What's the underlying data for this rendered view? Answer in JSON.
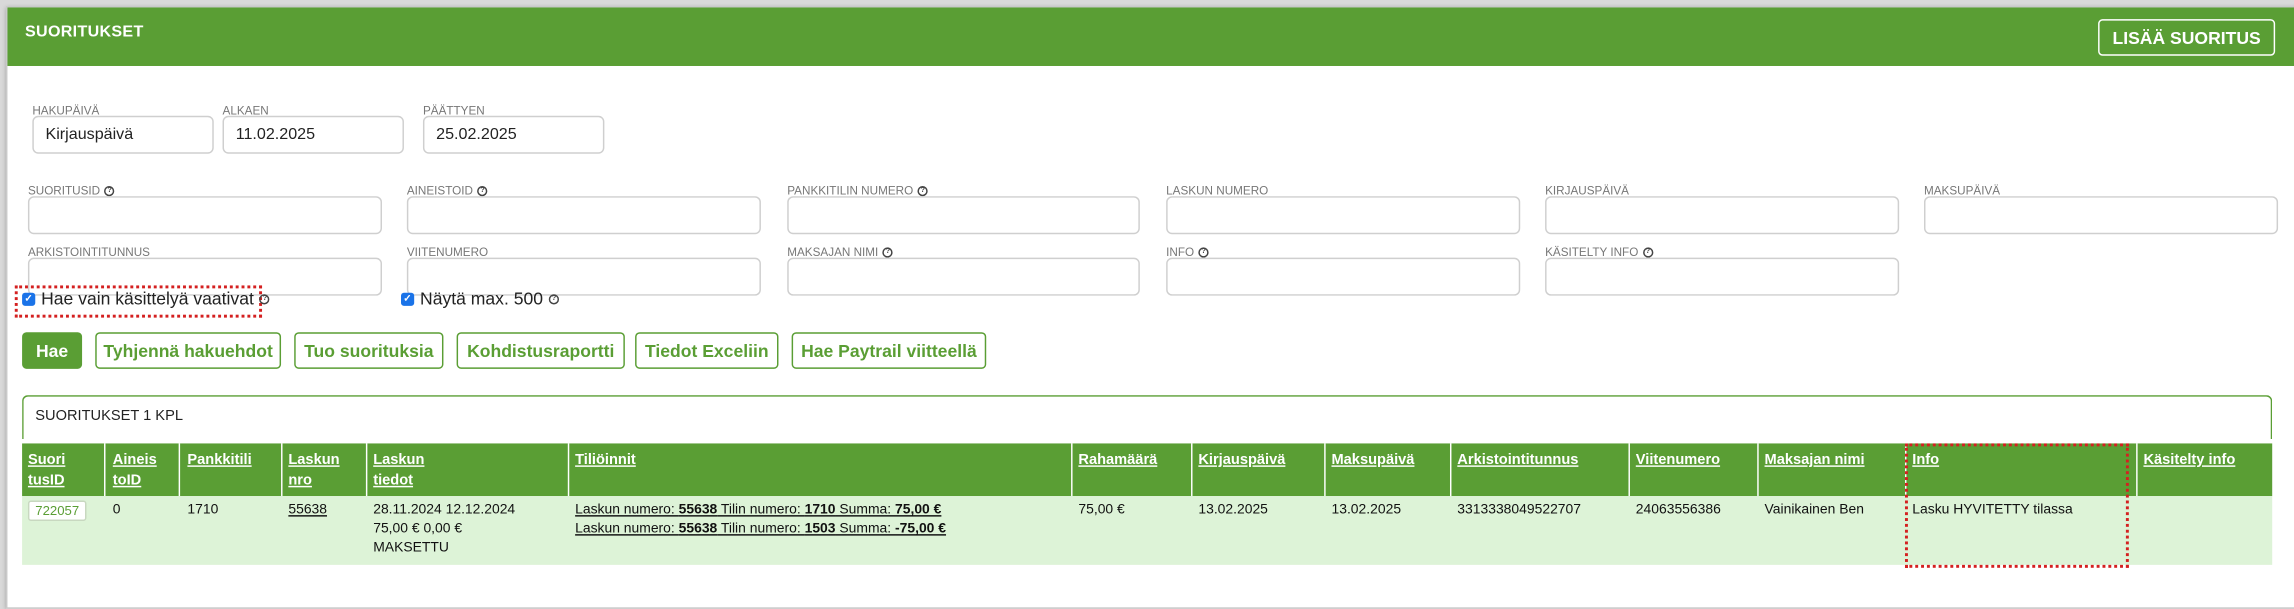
{
  "header": {
    "title": "SUORITUKSET",
    "add_button": "LISÄÄ SUORITUS"
  },
  "search": {
    "date_field": {
      "label": "HAKUPÄIVÄ",
      "value": "Kirjauspäivä"
    },
    "start": {
      "label": "ALKAEN",
      "value": "11.02.2025"
    },
    "end": {
      "label": "PÄÄTTYEN",
      "value": "25.02.2025"
    },
    "fields_row1": [
      {
        "label": "SUORITUSID",
        "help": true
      },
      {
        "label": "AINEISTOID",
        "help": true
      },
      {
        "label": "PANKKITILIN NUMERO",
        "help": true
      },
      {
        "label": "LASKUN NUMERO",
        "help": false
      },
      {
        "label": "KIRJAUSPÄIVÄ",
        "help": false
      },
      {
        "label": "MAKSUPÄIVÄ",
        "help": false
      }
    ],
    "fields_row2": [
      {
        "label": "ARKISTOINTITUNNUS",
        "help": false
      },
      {
        "label": "VIITENUMERO",
        "help": false
      },
      {
        "label": "MAKSAJAN NIMI",
        "help": true
      },
      {
        "label": "INFO",
        "help": true
      },
      {
        "label": "KÄSITELTY INFO",
        "help": true
      }
    ],
    "only_unprocessed": "Hae vain käsittelyä vaativat",
    "show_max": "Näytä max. 500"
  },
  "buttons": {
    "search": "Hae",
    "clear": "Tyhjennä hakuehdot",
    "import": "Tuo suorituksia",
    "report": "Kohdistusraportti",
    "excel": "Tiedot Exceliin",
    "paytrail": "Hae Paytrail viitteellä"
  },
  "results": {
    "count_label": "SUORITUKSET 1 KPL",
    "columns": {
      "id_1": "Suori",
      "id_2": "tusID",
      "aineisto_1": "Aineis",
      "aineisto_2": "toID",
      "pankkitili": "Pankkitili",
      "lasku_1": "Laskun",
      "lasku_2": "nro",
      "tiedot_1": "Laskun",
      "tiedot_2": "tiedot",
      "tilioinnit": "Tiliöinnit",
      "rahamaara": "Rahamäärä",
      "kirjauspaiva": "Kirjauspäivä",
      "maksupaiva": "Maksupäivä",
      "arkistointitunnus": "Arkistointitunnus",
      "viitenumero": "Viitenumero",
      "maksajan_nimi": "Maksajan nimi",
      "info": "Info",
      "kasitelty_info": "Käsitelty info"
    },
    "row": {
      "id": "722057",
      "aineisto": "0",
      "pankkitili": "1710",
      "lasku": "55638",
      "tiedot_1": "28.11.2024 12.12.2024",
      "tiedot_2": "75,00 € 0,00 €",
      "tiedot_3": "MAKSETTU",
      "t1_pre": "Laskun numero: ",
      "t1_lasku": "55638",
      "t1_tili_lbl": " Tilin numero: ",
      "t1_tili": "1710",
      "t1_summa_lbl": " Summa: ",
      "t1_summa": "75,00 €",
      "t2_pre": "Laskun numero: ",
      "t2_lasku": "55638",
      "t2_tili_lbl": " Tilin numero: ",
      "t2_tili": "1503",
      "t2_summa_lbl": " Summa: ",
      "t2_summa": "-75,00 €",
      "rahamaara": "75,00 €",
      "kirjauspaiva": "13.02.2025",
      "maksupaiva": "13.02.2025",
      "arkistointitunnus": "3313338049522707",
      "viitenumero": "24063556386",
      "maksajan_nimi": "Vainikainen Ben",
      "info": "Lasku HYVITETTY tilassa",
      "kasitelty_info": ""
    }
  },
  "colors": {
    "brand_green": "#5a9e34",
    "row_bg": "#ddf3d7",
    "highlight": "#d42020"
  }
}
